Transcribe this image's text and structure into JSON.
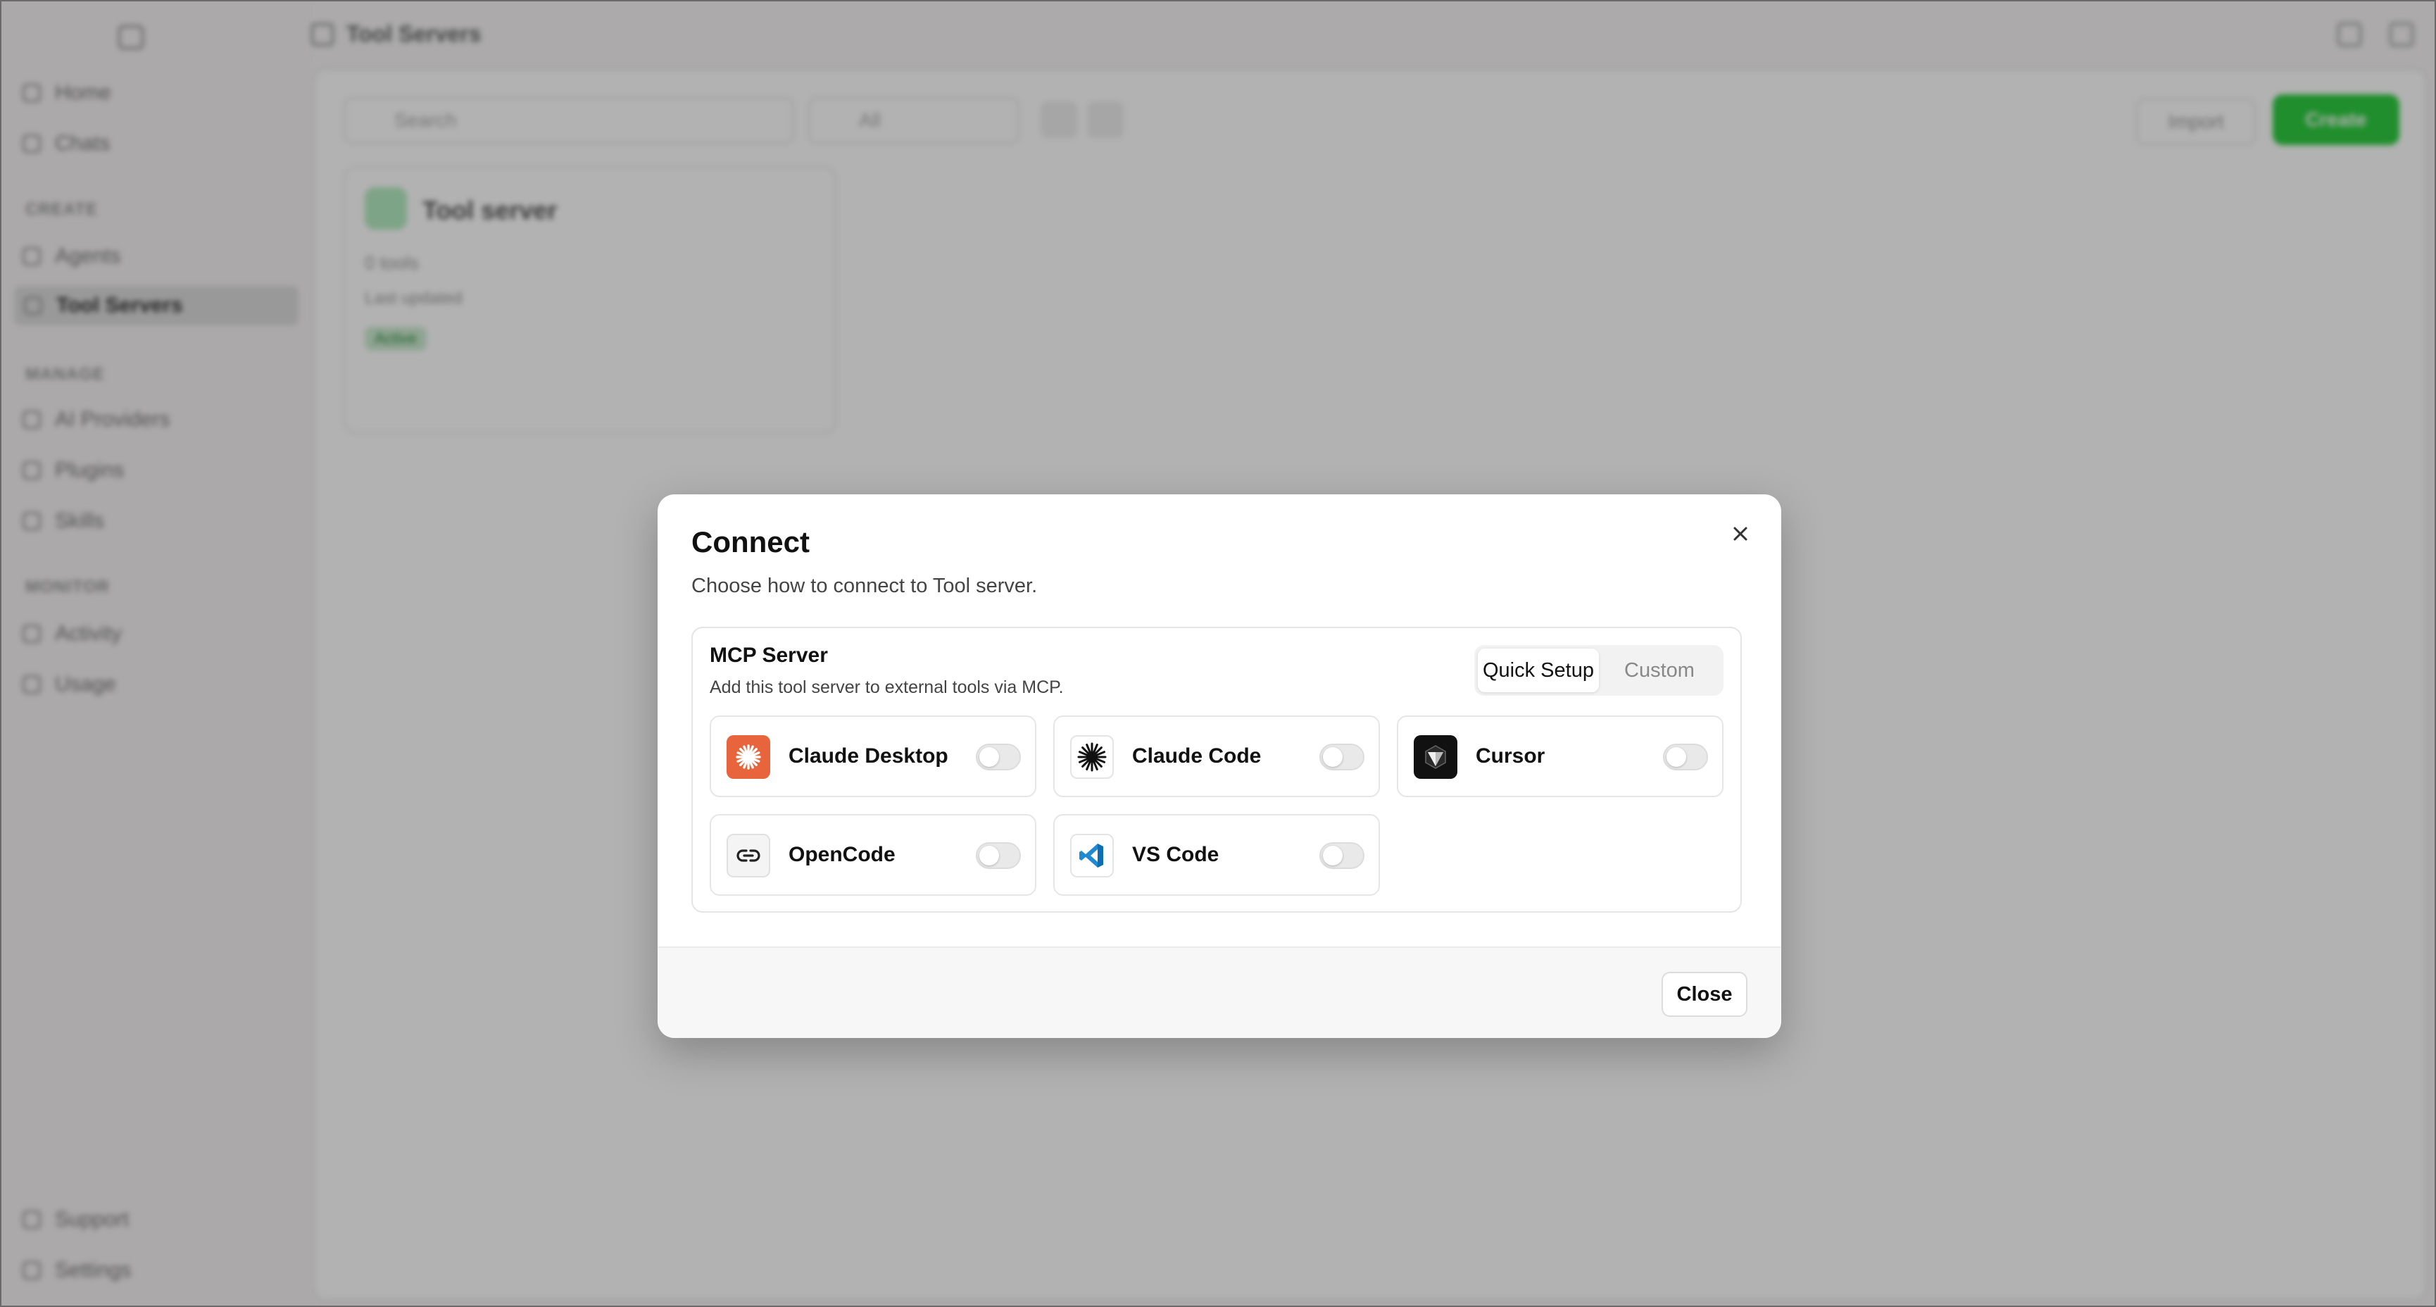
{
  "background": {
    "header": {
      "title": "Tool Servers"
    },
    "sidebar": {
      "items_top": [
        {
          "label": "Home",
          "icon": "home-icon"
        },
        {
          "label": "Chats",
          "icon": "chat-icon"
        }
      ],
      "section_create": "CREATE",
      "items_create": [
        {
          "label": "Agents",
          "icon": "agent-icon"
        },
        {
          "label": "Tool Servers",
          "icon": "server-icon"
        }
      ],
      "section_manage": "MANAGE",
      "items_manage": [
        {
          "label": "AI Providers",
          "icon": "ai-icon"
        },
        {
          "label": "Plugins",
          "icon": "plugin-icon"
        },
        {
          "label": "Skills",
          "icon": "skills-icon"
        }
      ],
      "section_monitor": "MONITOR",
      "items_monitor": [
        {
          "label": "Activity",
          "icon": "activity-icon"
        },
        {
          "label": "Usage",
          "icon": "usage-icon"
        }
      ],
      "items_bottom": [
        {
          "label": "Support",
          "icon": "support-icon"
        },
        {
          "label": "Settings",
          "icon": "settings-icon"
        }
      ]
    },
    "toolbar": {
      "search_placeholder": "Search",
      "filter_label": "All",
      "import_label": "Import",
      "create_label": "Create"
    },
    "server_card": {
      "name": "Tool server",
      "meta": "0 tools",
      "meta2": "Last updated",
      "tag": "Active"
    }
  },
  "modal": {
    "title": "Connect",
    "subtitle": "Choose how to connect to Tool server.",
    "mcp": {
      "title": "MCP Server",
      "description": "Add this tool server to external tools via MCP.",
      "tabs": [
        {
          "label": "Quick Setup",
          "active": true
        },
        {
          "label": "Custom",
          "active": false
        }
      ],
      "clients": [
        {
          "label": "Claude Desktop",
          "icon": "claude-desktop-icon",
          "enabled": false
        },
        {
          "label": "Claude Code",
          "icon": "claude-code-icon",
          "enabled": false
        },
        {
          "label": "Cursor",
          "icon": "cursor-icon",
          "enabled": false
        },
        {
          "label": "OpenCode",
          "icon": "opencode-icon",
          "enabled": false
        },
        {
          "label": "VS Code",
          "icon": "vscode-icon",
          "enabled": false
        }
      ]
    },
    "close_label": "Close"
  },
  "colors": {
    "claude_orange": "#e8643c",
    "vscode_blue": "#1f8ad2",
    "create_green": "#2ecc40"
  }
}
